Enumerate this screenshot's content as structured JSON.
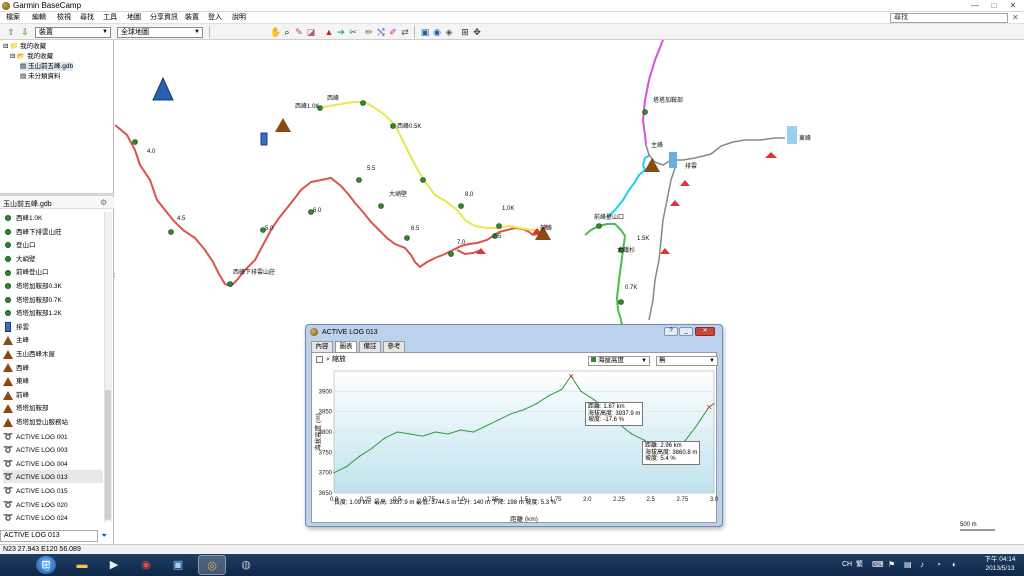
{
  "window": {
    "title": "Garmin BaseCamp",
    "min": "—",
    "max": "□",
    "close": "✕"
  },
  "menu": [
    "檔案",
    "編輯",
    "檢視",
    "尋找",
    "工具",
    "地圖",
    "分享資訊",
    "裝置",
    "登入",
    "說明"
  ],
  "search": {
    "value": "尋找"
  },
  "toolbar": {
    "device_select": "裝置",
    "map_select": "全球地圖"
  },
  "library": {
    "root": "我的收藏",
    "items": [
      {
        "label": "我的收藏"
      },
      {
        "label": "玉山前五峰.gdb"
      },
      {
        "label": "未分類資料"
      }
    ]
  },
  "list": {
    "header": "玉山前五峰.gdb",
    "items": [
      {
        "label": "西峰1.0K",
        "icon": "waypoint-dot"
      },
      {
        "label": "西峰下排雲山莊",
        "icon": "waypoint-dot"
      },
      {
        "label": "登山口",
        "icon": "waypoint-dot"
      },
      {
        "label": "大峭壁",
        "icon": "waypoint-dot"
      },
      {
        "label": "前峰登山口",
        "icon": "waypoint-dot"
      },
      {
        "label": "塔塔加鞍部0.3K",
        "icon": "waypoint-dot"
      },
      {
        "label": "塔塔加鞍部0.7K",
        "icon": "waypoint-dot"
      },
      {
        "label": "塔塔加鞍部1.2K",
        "icon": "waypoint-dot"
      },
      {
        "label": "排雲",
        "icon": "building-icon"
      },
      {
        "label": "主峰",
        "icon": "summit-icon"
      },
      {
        "label": "玉山西峰木屋",
        "icon": "summit-icon"
      },
      {
        "label": "西峰",
        "icon": "summit-icon"
      },
      {
        "label": "東峰",
        "icon": "summit-icon"
      },
      {
        "label": "前峰",
        "icon": "summit-icon"
      },
      {
        "label": "塔塔加鞍部",
        "icon": "summit-icon"
      },
      {
        "label": "塔塔加登山服務站",
        "icon": "summit-icon"
      },
      {
        "label": "ACTIVE LOG 001",
        "icon": "track-icon"
      },
      {
        "label": "ACTIVE LOG 003",
        "icon": "track-icon"
      },
      {
        "label": "ACTIVE LOG 004",
        "icon": "track-icon"
      },
      {
        "label": "ACTIVE LOG 013",
        "icon": "track-icon"
      },
      {
        "label": "ACTIVE LOG 015",
        "icon": "track-icon"
      },
      {
        "label": "ACTIVE LOG 020",
        "icon": "track-icon"
      },
      {
        "label": "ACTIVE LOG 024",
        "icon": "track-icon"
      }
    ],
    "footer_select": "ACTIVE LOG 013"
  },
  "map": {
    "labels": [
      "西峰1.0K",
      "西峰",
      "西峰0.5K",
      "西峰下排雲山莊",
      "前峰",
      "大峭壁",
      "前峰登山口",
      "塔塔加鞍部",
      "主峰",
      "東峰",
      "排雲",
      "4.0",
      "4.5",
      "5.0",
      "5.5",
      "6.0",
      "6.5",
      "7.0",
      "7.5",
      "8.0",
      "1.0K",
      "1.5K",
      "0.7K",
      "大鐵杉",
      "塔塔加鞍部0.3K"
    ],
    "scale_label": "500 m"
  },
  "status": {
    "coords": "N23 27.943 E120 56.089"
  },
  "taskbar": {
    "tray": [
      "CH",
      "繁"
    ],
    "clock_time": "下午 04:14",
    "clock_date": "2013/5/13"
  },
  "log_window": {
    "title": "ACTIVE LOG 013",
    "tabs": [
      "內容",
      "圖表",
      "備註",
      "參考"
    ],
    "zoom_label": "縮放",
    "select_y": "海拔高度",
    "select_x": "無",
    "stats": "最高: 3937.9 m  最低: 3744.5 m  上升: 140 m  下降: 198 m  坡度: 5.3 %",
    "tooltip1": [
      "距離: 1.87 km",
      "海拔高度: 3937.9 m",
      "坡度: -17.6 %"
    ],
    "tooltip2": [
      "距離: 2.96 km",
      "海拔高度: 3860.8 m",
      "坡度: 5.4 %"
    ],
    "start_label": "長度: 1.09 km"
  },
  "chart_data": {
    "type": "line",
    "xlabel": "距離 (km)",
    "ylabel": "海拔高度 (m)",
    "xlim": [
      0.0,
      3.0
    ],
    "ylim": [
      3650,
      3950
    ],
    "xticks": [
      "0.0",
      "0.25",
      "0.5",
      "0.75",
      "1.0",
      "1.25",
      "1.5",
      "1.75",
      "2.0",
      "2.25",
      "2.5",
      "2.75",
      "3.0"
    ],
    "yticks": [
      "3650",
      "3700",
      "3750",
      "3800",
      "3850",
      "3900"
    ],
    "series": [
      {
        "x": [
          0.0,
          0.1,
          0.2,
          0.3,
          0.4,
          0.5,
          0.6,
          0.7,
          0.8,
          0.9,
          1.0,
          1.1,
          1.2,
          1.3,
          1.4,
          1.5,
          1.6,
          1.7,
          1.8,
          1.87,
          1.95,
          2.05,
          2.15,
          2.25,
          2.35,
          2.45,
          2.55,
          2.65,
          2.75,
          2.85,
          2.96,
          3.0
        ],
        "y": [
          3700,
          3715,
          3740,
          3760,
          3785,
          3800,
          3795,
          3790,
          3800,
          3795,
          3805,
          3800,
          3815,
          3830,
          3845,
          3855,
          3870,
          3890,
          3905,
          3938,
          3900,
          3880,
          3855,
          3820,
          3795,
          3780,
          3760,
          3750,
          3770,
          3810,
          3861,
          3870
        ]
      }
    ]
  }
}
